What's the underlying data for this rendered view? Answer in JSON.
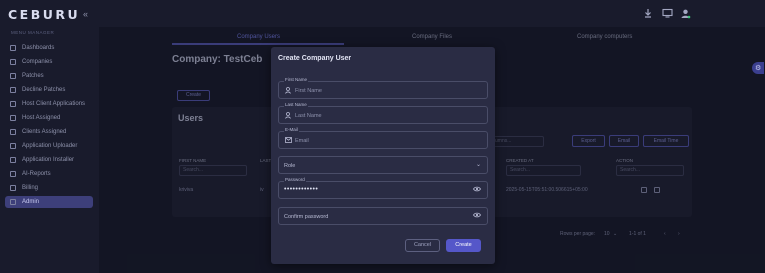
{
  "app": {
    "logo": "CEBURU",
    "collapse_glyph": "«"
  },
  "topbar": {
    "icons": [
      "download-icon",
      "monitor-icon",
      "user-avatar-icon"
    ]
  },
  "sidebar": {
    "heading": "MENU MANAGER",
    "items": [
      {
        "label": "Dashboards",
        "icon": "dashboard-icon",
        "active": false
      },
      {
        "label": "Companies",
        "icon": "companies-icon",
        "active": false
      },
      {
        "label": "Patches",
        "icon": "patches-icon",
        "active": false
      },
      {
        "label": "Decline Patches",
        "icon": "decline-icon",
        "active": false
      },
      {
        "label": "Host Client Applications",
        "icon": "apps-icon",
        "active": false
      },
      {
        "label": "Host Assigned",
        "icon": "host-icon",
        "active": false
      },
      {
        "label": "Clients Assigned",
        "icon": "clients-icon",
        "active": false
      },
      {
        "label": "Application Uploader",
        "icon": "upload-icon",
        "active": false
      },
      {
        "label": "Application Installer",
        "icon": "installer-icon",
        "active": false
      },
      {
        "label": "AI-Reports",
        "icon": "reports-icon",
        "active": false
      },
      {
        "label": "Billing",
        "icon": "billing-icon",
        "active": false
      },
      {
        "label": "Admin",
        "icon": "admin-icon",
        "active": true
      }
    ]
  },
  "main": {
    "tabs": [
      "Company Users",
      "Company Files",
      "Company computers"
    ],
    "page_title": "Company: TestCeb",
    "create_button": "Create",
    "users_title": "Users",
    "search_placeholder": "Search all columns...",
    "toolbar_buttons": [
      "Export",
      "Email",
      "Email Time"
    ],
    "columns": [
      "FIRST NAME",
      "LAST",
      "CREATED AT",
      "ACTION"
    ],
    "filter_placeholder": "Search...",
    "row": {
      "first_name": "kriviva",
      "last": "iv",
      "created_at": "2025-05-15T05:51:00.506615+05:00"
    },
    "pager": {
      "rows_per_page_label": "Rows per page:",
      "rows_per_page": "10",
      "range": "1-1 of 1"
    }
  },
  "modal": {
    "title": "Create Company User",
    "fields": {
      "first_name": {
        "label": "First Name",
        "placeholder": "First Name"
      },
      "last_name": {
        "label": "Last Name",
        "placeholder": "Last Name"
      },
      "email": {
        "label": "E-Mail",
        "placeholder": "Email"
      },
      "role": {
        "placeholder": "Role"
      },
      "password": {
        "label": "Password",
        "value": "••••••••••••"
      },
      "confirm_password": {
        "placeholder": "Confirm password"
      }
    },
    "cancel_label": "Cancel",
    "create_label": "Create"
  },
  "colors": {
    "accent": "#5557c9",
    "background": "#1c1f33",
    "modal": "#2a2c44"
  }
}
